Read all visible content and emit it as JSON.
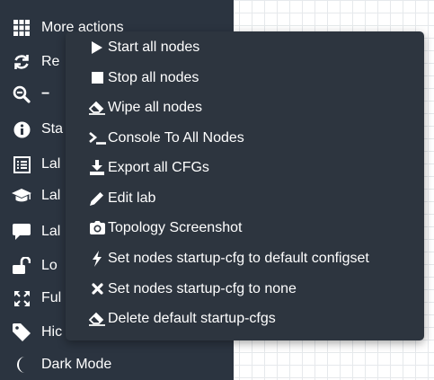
{
  "colors": {
    "sidebar_bg": "#2b3440",
    "menu_bg": "#2d353f",
    "text": "#ffffff",
    "canvas_grid": "#e6e9ec"
  },
  "sidebar": {
    "items": [
      {
        "label": "More actions",
        "icon": "grid-icon"
      },
      {
        "label": "Re",
        "icon": "refresh-icon"
      },
      {
        "label": "−",
        "icon": "zoom-out-icon"
      },
      {
        "label": "Sta",
        "icon": "info-icon"
      },
      {
        "label": "Lal",
        "icon": "list-icon"
      },
      {
        "label": "Lal",
        "icon": "graduation-cap-icon"
      },
      {
        "label": "Lal",
        "icon": "comment-icon"
      },
      {
        "label": "Lo",
        "icon": "unlock-icon"
      },
      {
        "label": "Ful",
        "icon": "expand-icon"
      },
      {
        "label": "Hic",
        "icon": "tag-icon"
      },
      {
        "label": "Dark Mode",
        "icon": "moon-icon"
      }
    ]
  },
  "menu": {
    "items": [
      {
        "label": "Start all nodes",
        "icon": "play-icon"
      },
      {
        "label": "Stop all nodes",
        "icon": "stop-icon"
      },
      {
        "label": "Wipe all nodes",
        "icon": "eraser-icon"
      },
      {
        "label": "Console To All Nodes",
        "icon": "terminal-icon"
      },
      {
        "label": "Export all CFGs",
        "icon": "download-icon"
      },
      {
        "label": "Edit lab",
        "icon": "pencil-icon"
      },
      {
        "label": "Topology Screenshot",
        "icon": "camera-icon"
      },
      {
        "label": "Set nodes startup-cfg to default configset",
        "icon": "bolt-icon"
      },
      {
        "label": "Set nodes startup-cfg to none",
        "icon": "times-icon"
      },
      {
        "label": "Delete default startup-cfgs",
        "icon": "eraser-icon"
      }
    ]
  }
}
